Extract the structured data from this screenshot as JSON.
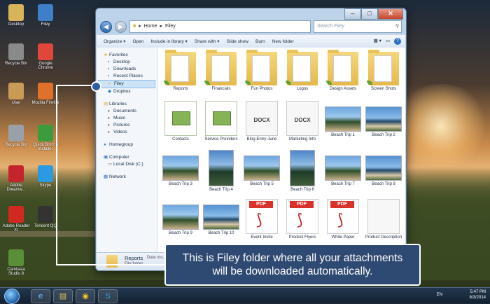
{
  "desktop": {
    "icons": [
      {
        "label": "Desktop"
      },
      {
        "label": "Filey"
      },
      {
        "label": "Recycle Bin"
      },
      {
        "label": "Google Chrome"
      },
      {
        "label": "User"
      },
      {
        "label": "Mozilla Firefox"
      },
      {
        "label": "Recycle Bin"
      },
      {
        "label": "Quick Bro Hp Installer"
      },
      {
        "label": "Adobe Dreamw..."
      },
      {
        "label": "Skype"
      },
      {
        "label": "Adobe Reader XI"
      },
      {
        "label": "Tencent QQ"
      },
      {
        "label": "Camtasia Studio 8"
      }
    ]
  },
  "window": {
    "address": {
      "home": "Home",
      "sep": "▸",
      "folder": "Filey"
    },
    "search_placeholder": "Search Filey",
    "toolbar": [
      "Organize ▾",
      "Open",
      "Include in library ▾",
      "Share with ▾",
      "Slide show",
      "Burn",
      "New folder"
    ],
    "nav": {
      "favorites": {
        "label": "Favorites",
        "items": [
          "Desktop",
          "Downloads",
          "Recent Places",
          "Filey",
          "Dropbox"
        ]
      },
      "libraries": {
        "label": "Libraries",
        "items": [
          "Documents",
          "Music",
          "Pictures",
          "Videos"
        ]
      },
      "homegroup": "Homegroup",
      "computer": {
        "label": "Computer",
        "items": [
          "Local Disk (C:)"
        ]
      },
      "network": "Network"
    },
    "files": [
      {
        "name": "Reports",
        "kind": "folder"
      },
      {
        "name": "Financials",
        "kind": "folder"
      },
      {
        "name": "Fun Photos",
        "kind": "folder"
      },
      {
        "name": "Logos",
        "kind": "folder"
      },
      {
        "name": "Design Assets",
        "kind": "folder"
      },
      {
        "name": "Screen Shots",
        "kind": "folder"
      },
      {
        "name": "Contacts",
        "kind": "xls"
      },
      {
        "name": "Service Providers",
        "kind": "xls"
      },
      {
        "name": "Blog Entry-June",
        "kind": "docx",
        "tag": "DOCX"
      },
      {
        "name": "Marketing Info",
        "kind": "docx",
        "tag": "DOCX"
      },
      {
        "name": "Beach Trip 1",
        "kind": "photo"
      },
      {
        "name": "Beach Trip 2",
        "kind": "photo"
      },
      {
        "name": "Beach Trip 3",
        "kind": "photo"
      },
      {
        "name": "Beach Trip 4",
        "kind": "tall"
      },
      {
        "name": "Beach Trip 5",
        "kind": "photo"
      },
      {
        "name": "Beach Trip 6",
        "kind": "tall"
      },
      {
        "name": "Beach Trip 7",
        "kind": "photo"
      },
      {
        "name": "Beach Trip 8",
        "kind": "photo"
      },
      {
        "name": "Beach Trip 9",
        "kind": "photo"
      },
      {
        "name": "Beach Trip 10",
        "kind": "photo"
      },
      {
        "name": "Event Invite",
        "kind": "pdf",
        "tag": "PDF"
      },
      {
        "name": "Product Flyers",
        "kind": "pdf",
        "tag": "PDF"
      },
      {
        "name": "White Paper",
        "kind": "pdf",
        "tag": "PDF"
      },
      {
        "name": "Product Description",
        "kind": "generic"
      }
    ],
    "details": {
      "name": "Reports",
      "type": "File folder",
      "date_label": "Date mo..."
    }
  },
  "callout": {
    "line1": "This is Filey folder where all your attachments",
    "line2": "will be downloaded automatically."
  },
  "taskbar": {
    "lang": "EN",
    "time": "5:47 PM",
    "date": "6/3/2014"
  }
}
